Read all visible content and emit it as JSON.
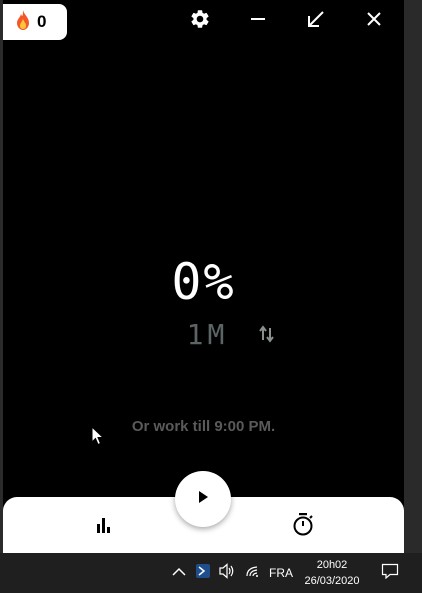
{
  "streak": {
    "icon": "fire-icon",
    "count": "0"
  },
  "titlebar": {
    "settings_icon": "gear-icon",
    "minimize_icon": "minimize-icon",
    "collapse_icon": "arrow-down-left-icon",
    "close_icon": "close-icon"
  },
  "main": {
    "percent": "0%",
    "duration": "1M",
    "swap_icon": "swap-vertical-icon",
    "work_till": "Or work till 9:00 PM."
  },
  "bottom_bar": {
    "stats_icon": "bar-chart-icon",
    "play_icon": "play-icon",
    "timer_icon": "stopwatch-icon"
  },
  "taskbar": {
    "language": "FRA",
    "time": "20h02",
    "date": "26/03/2020"
  },
  "colors": {
    "app_bg": "#000000",
    "taskbar_bg": "#1f1f1f",
    "duration_text": "#5c6466",
    "worktill_text": "#5a5a5a"
  }
}
